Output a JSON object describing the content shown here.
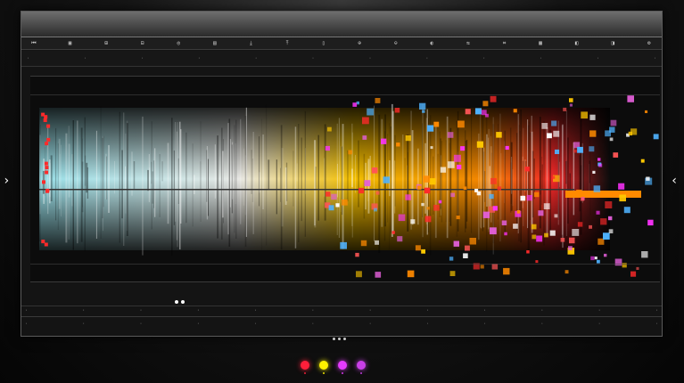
{
  "window": {
    "title": ""
  },
  "toolbar": {
    "buttons": [
      {
        "label": "⏮"
      },
      {
        "label": "▣"
      },
      {
        "label": "⊞"
      },
      {
        "label": "⊟"
      },
      {
        "label": "◎"
      },
      {
        "label": "▤"
      },
      {
        "label": "⤓"
      },
      {
        "label": "⤒"
      },
      {
        "label": "▯"
      },
      {
        "label": "⊕"
      },
      {
        "label": "⊖"
      },
      {
        "label": "◐"
      },
      {
        "label": "⇆"
      },
      {
        "label": "⌗"
      },
      {
        "label": "▦"
      },
      {
        "label": "◧"
      },
      {
        "label": "◨"
      },
      {
        "label": "⚙"
      }
    ]
  },
  "plot": {
    "section_label": "",
    "footer_label_1": "",
    "footer_label_2": ""
  },
  "colors": {
    "cyan": "#9fe9f2",
    "white": "#f4f4f0",
    "yellow": "#ffc800",
    "orange": "#ff8a00",
    "red": "#ff2a2a",
    "magenta": "#ff33ff",
    "pink": "#e25fd8"
  },
  "swatches": [
    {
      "name": "red",
      "color": "#ff1f3a"
    },
    {
      "name": "yellow",
      "color": "#fff200"
    },
    {
      "name": "magenta",
      "color": "#e53bff"
    },
    {
      "name": "pink",
      "color": "#c93fe8"
    }
  ],
  "navigation": {
    "prev_icon": "chevron-left-icon",
    "next_icon": "chevron-right-icon"
  }
}
